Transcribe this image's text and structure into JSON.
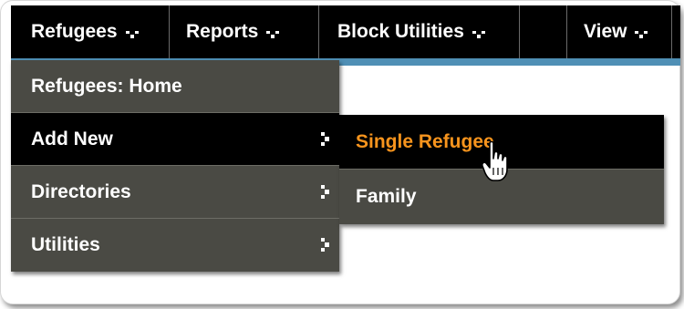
{
  "menubar": {
    "items": [
      {
        "label": "Refugees"
      },
      {
        "label": "Reports"
      },
      {
        "label": "Block Utilities"
      },
      {
        "label": ""
      },
      {
        "label": "View"
      }
    ]
  },
  "dropdown": {
    "items": [
      {
        "label": "Refugees: Home",
        "has_submenu": false
      },
      {
        "label": "Add New",
        "has_submenu": true
      },
      {
        "label": "Directories",
        "has_submenu": true
      },
      {
        "label": "Utilities",
        "has_submenu": true
      }
    ]
  },
  "submenu": {
    "items": [
      {
        "label": "Single Refugee"
      },
      {
        "label": "Family"
      }
    ]
  },
  "colors": {
    "menubar_bg": "#000000",
    "menu_bg": "#4a4a44",
    "accent_underline": "#4f8fb5",
    "hover_text": "#f7941d"
  },
  "icons": [
    "chevron-down-icon",
    "chevron-right-icon",
    "hand-pointer-cursor-icon"
  ]
}
